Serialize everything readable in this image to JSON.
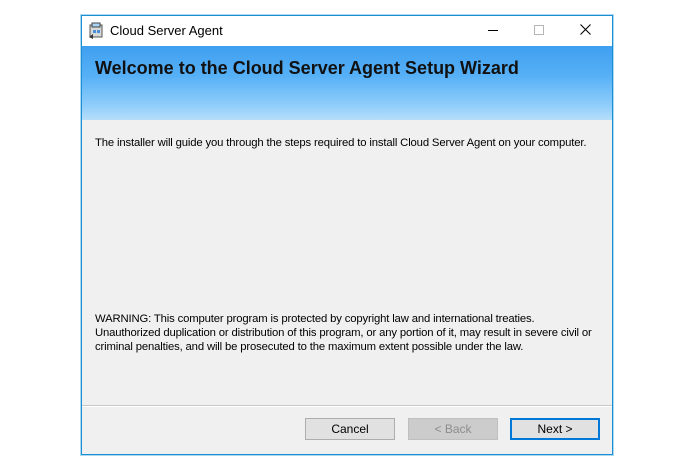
{
  "window": {
    "title": "Cloud Server Agent",
    "controls": {
      "minimize_icon": "minimize-icon",
      "maximize_icon": "maximize-icon",
      "close_icon": "close-icon"
    }
  },
  "banner": {
    "title": "Welcome to the Cloud Server Agent Setup Wizard"
  },
  "content": {
    "intro": "The installer will guide you through the steps required to install Cloud Server Agent on your computer.",
    "warning": "WARNING: This computer program is protected by copyright law and international treaties. Unauthorized duplication or distribution of this program, or any portion of it, may result in severe civil or criminal penalties, and will be prosecuted to the maximum extent possible under the law."
  },
  "buttons": {
    "cancel": "Cancel",
    "back": "< Back",
    "next": "Next >"
  },
  "colors": {
    "accent": "#0078d7",
    "banner_top": "#3f9ff0",
    "banner_bottom": "#b6def9",
    "window_border": "#1a8fd6"
  }
}
